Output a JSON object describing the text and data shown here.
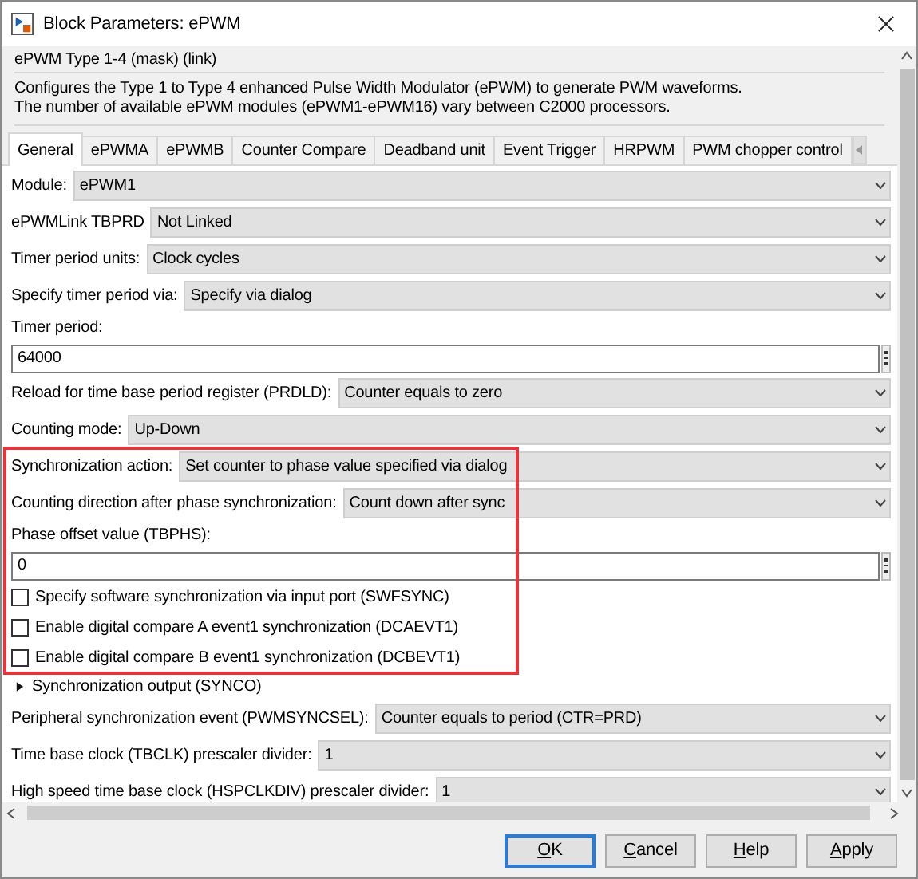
{
  "window": {
    "title": "Block Parameters: ePWM"
  },
  "mask": {
    "title": "ePWM Type 1-4 (mask) (link)",
    "description": [
      "Configures the Type 1 to Type 4 enhanced Pulse Width Modulator (ePWM) to generate PWM waveforms.",
      "The number of available ePWM modules (ePWM1-ePWM16) vary between C2000 processors."
    ]
  },
  "tabs": [
    {
      "label": "General",
      "selected": true
    },
    {
      "label": "ePWMA",
      "selected": false
    },
    {
      "label": "ePWMB",
      "selected": false
    },
    {
      "label": "Counter Compare",
      "selected": false
    },
    {
      "label": "Deadband unit",
      "selected": false
    },
    {
      "label": "Event Trigger",
      "selected": false
    },
    {
      "label": "HRPWM",
      "selected": false
    },
    {
      "label": "PWM chopper control",
      "selected": false
    }
  ],
  "parameters": [
    {
      "kind": "dropdown",
      "label": "Module:",
      "value": "ePWM1",
      "highlighted": false
    },
    {
      "kind": "dropdown",
      "label": "ePWMLink TBPRD",
      "value": "Not Linked",
      "highlighted": false
    },
    {
      "kind": "dropdown",
      "label": "Timer period units:",
      "value": "Clock cycles",
      "highlighted": false
    },
    {
      "kind": "dropdown",
      "label": "Specify timer period via:",
      "value": "Specify via dialog",
      "highlighted": false
    },
    {
      "kind": "edit",
      "label": "Timer period:",
      "value": "64000",
      "highlighted": false
    },
    {
      "kind": "dropdown",
      "label": "Reload for time base period register (PRDLD):",
      "value": "Counter equals to zero",
      "highlighted": false
    },
    {
      "kind": "dropdown",
      "label": "Counting mode:",
      "value": "Up-Down",
      "highlighted": false
    },
    {
      "kind": "dropdown",
      "label": "Synchronization action:",
      "value": "Set counter to phase value specified via dialog",
      "highlighted": true
    },
    {
      "kind": "dropdown",
      "label": "Counting direction after phase synchronization:",
      "value": "Count down after sync",
      "highlighted": true
    },
    {
      "kind": "edit",
      "label": "Phase offset value (TBPHS):",
      "value": "0",
      "highlighted": true
    },
    {
      "kind": "checkbox",
      "label": "Specify software synchronization via input port (SWFSYNC)",
      "checked": false,
      "highlighted": true
    },
    {
      "kind": "checkbox",
      "label": "Enable digital compare A event1 synchronization (DCAEVT1)",
      "checked": false,
      "highlighted": true
    },
    {
      "kind": "checkbox",
      "label": "Enable digital compare B event1 synchronization (DCBEVT1)",
      "checked": false,
      "highlighted": true
    },
    {
      "kind": "section",
      "label": "Synchronization output (SYNCO)",
      "expanded": false,
      "highlighted": false
    },
    {
      "kind": "dropdown",
      "label": "Peripheral synchronization event (PWMSYNCSEL):",
      "value": "Counter equals to period (CTR=PRD)",
      "highlighted": false
    },
    {
      "kind": "dropdown",
      "label": "Time base clock (TBCLK) prescaler divider:",
      "value": "1",
      "highlighted": false
    },
    {
      "kind": "dropdown",
      "label": "High speed time base clock (HSPCLKDIV) prescaler divider:",
      "value": "1",
      "highlighted": false
    }
  ],
  "buttons": [
    {
      "mnemonic": "O",
      "label_rest": "K",
      "default": true
    },
    {
      "mnemonic": "C",
      "label_rest": "ancel",
      "default": false
    },
    {
      "mnemonic": "H",
      "label_rest": "elp",
      "default": false
    },
    {
      "mnemonic": "A",
      "label_rest": "pply",
      "default": false
    }
  ]
}
